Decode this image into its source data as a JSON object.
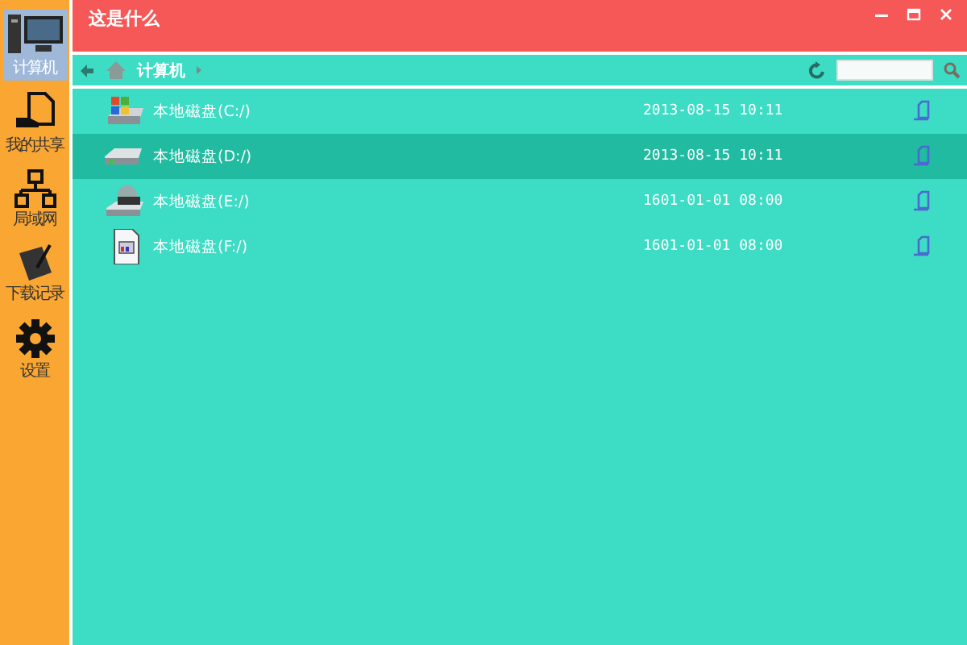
{
  "window": {
    "title": "这是什么"
  },
  "sidebar": {
    "items": [
      {
        "label": "计算机",
        "kind": "computer",
        "selected": true
      },
      {
        "label": "我的共享",
        "kind": "share",
        "selected": false
      },
      {
        "label": "局域网",
        "kind": "network",
        "selected": false
      },
      {
        "label": "下载记录",
        "kind": "download",
        "selected": false
      },
      {
        "label": "设置",
        "kind": "settings",
        "selected": false
      }
    ]
  },
  "breadcrumb": {
    "path": "计算机"
  },
  "drives": [
    {
      "name": "本地磁盘(C:/)",
      "date": "2013-08-15 10:11",
      "kind": "system",
      "selected": false
    },
    {
      "name": "本地磁盘(D:/)",
      "date": "2013-08-15 10:11",
      "kind": "disk",
      "selected": true
    },
    {
      "name": "本地磁盘(E:/)",
      "date": "1601-01-01 08:00",
      "kind": "network",
      "selected": false
    },
    {
      "name": "本地磁盘(F:/)",
      "date": "1601-01-01 08:00",
      "kind": "file",
      "selected": false
    }
  ]
}
